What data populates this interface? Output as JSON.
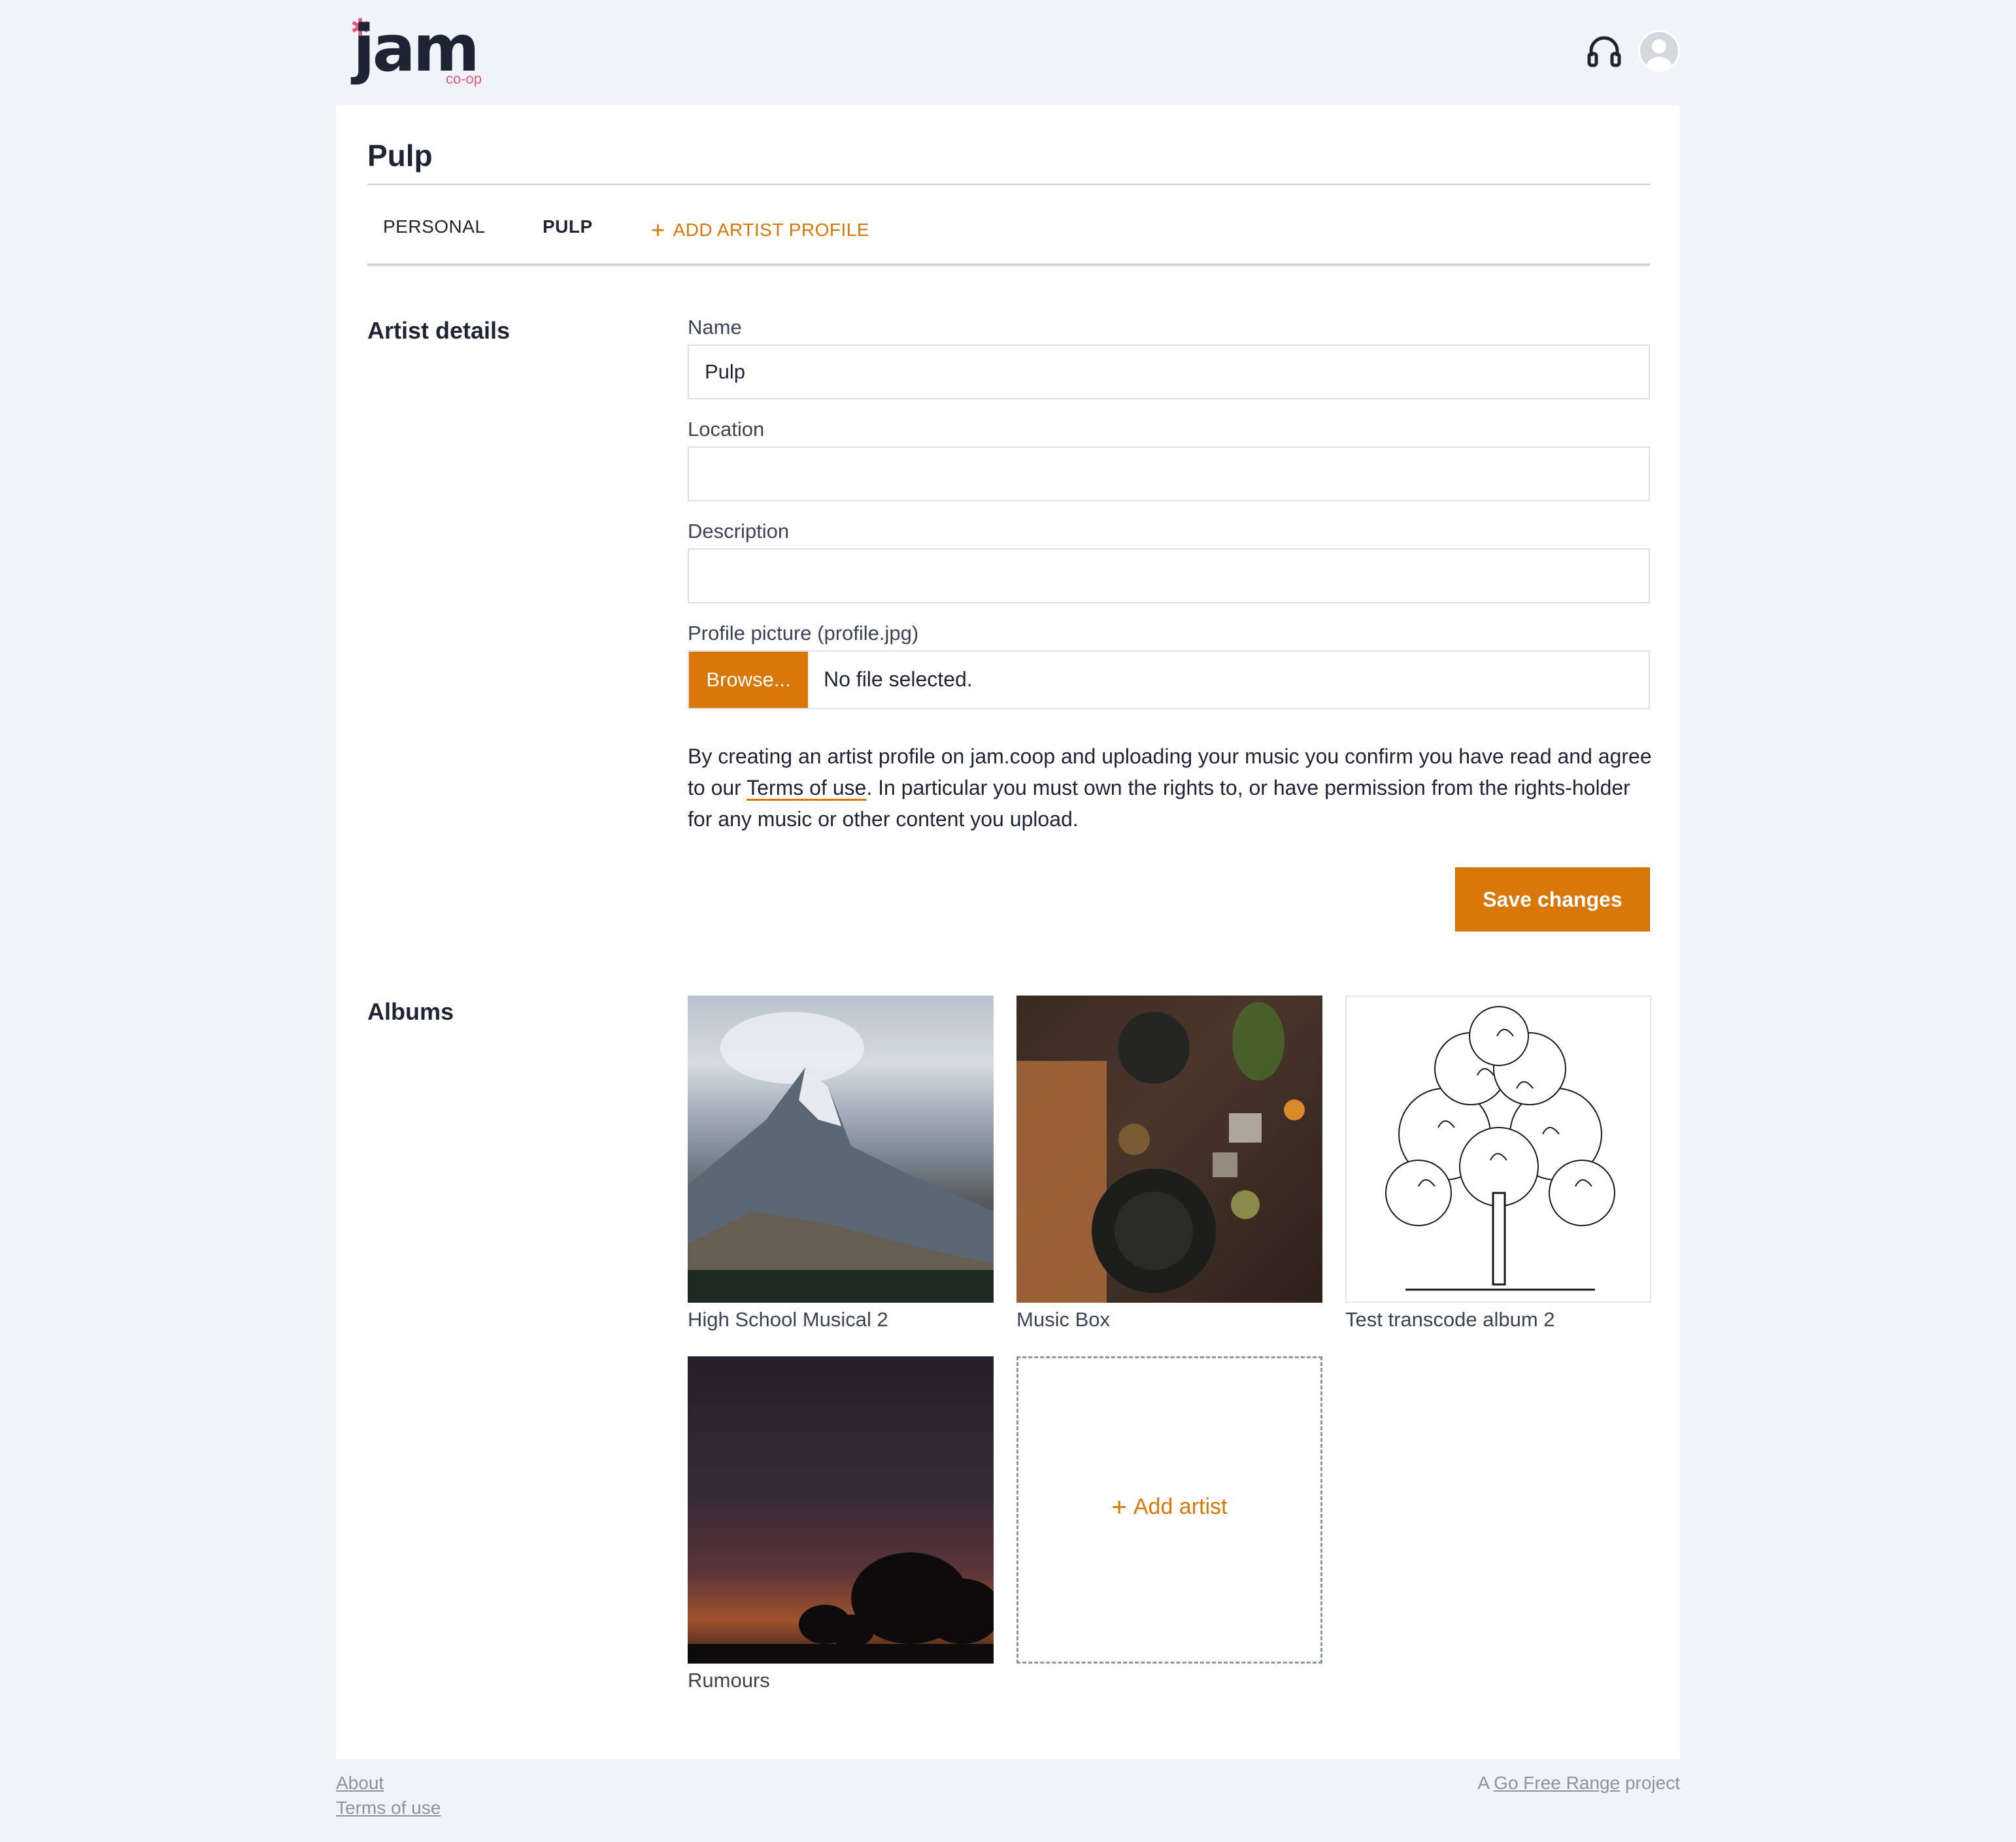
{
  "brand": {
    "logo_text": "jam",
    "logo_sub": "co-op"
  },
  "header": {
    "headphones_icon": "headphones-icon",
    "avatar_icon": "user-avatar-icon"
  },
  "page": {
    "title": "Pulp"
  },
  "tabs": [
    {
      "label": "PERSONAL"
    },
    {
      "label": "PULP",
      "active": true
    },
    {
      "label": "ADD ARTIST PROFILE"
    }
  ],
  "artist_details": {
    "heading": "Artist details",
    "name_label": "Name",
    "name_value": "Pulp",
    "location_label": "Location",
    "location_value": "",
    "description_label": "Description",
    "description_value": "",
    "picture_label": "Profile picture (profile.jpg)",
    "browse_label": "Browse...",
    "file_status": "No file selected.",
    "terms_before": "By creating an artist profile on jam.coop and uploading your music you confirm you have read and agree to our ",
    "terms_link": "Terms of use",
    "terms_after": ". In particular you must own the rights to, or have permission from the rights-holder for any music or other content you upload.",
    "save_label": "Save changes"
  },
  "albums": {
    "heading": "Albums",
    "items": [
      {
        "title": "High School Musical 2"
      },
      {
        "title": "Music Box"
      },
      {
        "title": "Test transcode album 2"
      },
      {
        "title": "Rumours"
      }
    ],
    "add_label": "Add artist"
  },
  "footer": {
    "about": "About",
    "terms": "Terms of use",
    "credit_prefix": "A ",
    "credit_link": "Go Free Range",
    "credit_suffix": " project"
  },
  "colors": {
    "accent": "#d97706",
    "brand_pink": "#e8587a",
    "background": "#f0f3f7"
  }
}
